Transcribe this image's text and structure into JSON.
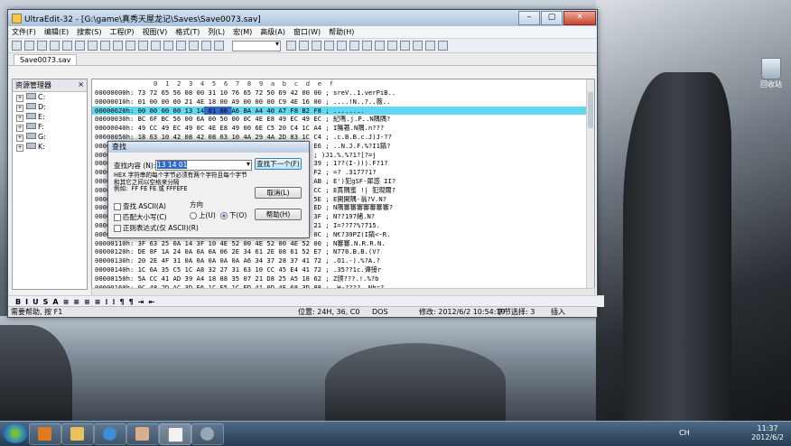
{
  "window": {
    "title": "UltraEdit-32 - [G:\\game\\真秀天屋龙记\\Saves\\Save0073.sav]",
    "buttons": {
      "minimize": "–",
      "maximize": "▢",
      "close": "✕"
    }
  },
  "menu": [
    "文件(F)",
    "编辑(E)",
    "搜索(S)",
    "工程(P)",
    "视图(V)",
    "格式(T)",
    "列(L)",
    "宏(M)",
    "高级(A)",
    "窗口(W)",
    "帮助(H)"
  ],
  "tab": {
    "label": "Save0073.sav"
  },
  "explorer": {
    "title": "资源管理器",
    "drives": [
      "C:",
      "D:",
      "E:",
      "F:",
      "G:",
      "K:"
    ]
  },
  "hex": {
    "ruler": "0  1  2  3  4  5  6  7  8  9  a  b  c  d  e  f",
    "highlight_row": 2,
    "rows": [
      {
        "addr": "00000000h:",
        "bytes": "73 72 65 56 08 00 31 10 76 65 72 50 69 42 00 00",
        "text": "; sreV..1.verPiB.."
      },
      {
        "addr": "00000010h:",
        "bytes": "01 00 00 00 21 4E 18 00 A9 00 00 00 C9 4E 16 00",
        "text": "; ....!N..?..薇.."
      },
      {
        "addr": "00000020h:",
        "bytes": "00 00 00 00 13 14 01 00 A6 BA A4 40 A7 F8 B2 F8",
        "text": "; ........"
      },
      {
        "addr": "00000030h:",
        "bytes": "BC 6F BC 56 00 6A 00 50 00 0C 4E E8 49 EC 49 EC",
        "text": "; 紀嗎.j.P..N隅隅?"
      },
      {
        "addr": "00000040h:",
        "bytes": "49 CC 49 EC 49 0C 4E E8 49 00 6E C5 20 C4 1C A4",
        "text": "; I隲著.N隅.n???"
      },
      {
        "addr": "00000050h:",
        "bytes": "18 63 10 42 08 42 08 63 10 4A 29 4A 2D 83 1C C4",
        "text": "; .c.B.B.c.J)J-??"
      },
      {
        "addr": "00000060h:",
        "bytes": "08 0B 4E 2E 4A 0E 46 07 25 A5 18 49 31 EF 55 E6",
        "text": "; ..N.J.F.%?I1錆?"
      },
      {
        "addr": "00000070h:",
        "bytes": "29 4A 31 0F 25 07 25 8C 31 0D 5B 81 CD 3D 6A",
        "text": "; )J1.%.%?1?[?=j"
      },
      {
        "addr": "00000080h:",
        "bytes": "31 0F 28 29 4A 31 0F 29 4A 31 0F 3F 6A 31 8E 39",
        "text": "; 1??(I-))).F?1?"
      },
      {
        "addr": "00000090h:",
        "bytes": "D4 9E 3F 1F 3D DF 7B 3D 0F 3F 21 43 3F 15 C9 F2",
        "text": "; =? .3177?1?"
      },
      {
        "addr": "000000a0h:",
        "bytes": "28 1B 29 8A 31 8F 59 07 C9 40 BD 38 AA 3E B2 AB",
        "text": "; E')犯gSF-犀惑 II?"
      },
      {
        "addr": "000000b0h:",
        "bytes": "8E C9 19 15 45 00 00 00 00 00 00 00 16 4E 7A CC",
        "text": "; E貫隅蜜 !| 犯現爾?"
      },
      {
        "addr": "000000c0h:",
        "bytes": "18 00 0C 4E 94 56 54 EC 4E F6 AD 15 EF 5B 3F 5E",
        "text": "; E開開隅·翁?V.N?"
      },
      {
        "addr": "000000d0h:",
        "bytes": "49 6E EC 6E 49 EC C4 49 EC 49 C4 49 EC 49 C4 ED",
        "text": "; N隅審審審審審審審?"
      },
      {
        "addr": "000000e0h:",
        "bytes": "49 0C 4E 0F 31 00 E7 31 24 0C E8 18 0C 4E 4E 3F",
        "text": "; N??197緒.N?"
      },
      {
        "addr": "000000f0h:",
        "bytes": "40 68 49 49 49 0C 37 70 37 37 06 04 37 06 39 21",
        "text": "; I=??7?%?715."
      },
      {
        "addr": "00000100h:",
        "bytes": "0C 4E F7 38 35 1C 50 50 32 2E 28 0D 00 00 00 0C",
        "text": "; N€?39PZ(I錆<-R."
      },
      {
        "addr": "00000110h:",
        "bytes": "3F 63 25 0A 14 3F 10 4E 52 00 4E 52 00 4E 52 00",
        "text": "; N審審.N.R.R.N."
      },
      {
        "addr": "00000120h:",
        "bytes": "DE 8F 1A 24 0A 0A 0A 06 2E 34 61 2E 08 61 52 E7",
        "text": "; N778.B.B.(V?"
      },
      {
        "addr": "00000130h:",
        "bytes": "20 2E 4F 31 0A 0A 0A 0A 0A A6 34 37 28 37 41 72",
        "text": "; .O1.-).%?A.?"
      },
      {
        "addr": "00000140h:",
        "bytes": "1C 6A 35 C5 1C A8 32 27 31 63 10 CC 45 E4 41 72",
        "text": "; .35??1c.谭接r"
      },
      {
        "addr": "00000150h:",
        "bytes": "5A CC 41 AD 39 A4 18 88 35 07 21 D8 25 A5 18 62",
        "text": "; Z颁???.!.%?b"
      },
      {
        "addr": "00000160h:",
        "bytes": "0C 48 2D AC 3D E6 1C E5 1C ED 41 0D 4E 68 3D 88",
        "text": "; .H-???? .Nh=?"
      },
      {
        "addr": "00000170h:",
        "bytes": "41 27 3D 89 41 88 41 25 2D A8 45 48 35 67 31 A9",
        "text": "; A'=瓢隅…隅KSg1?"
      },
      {
        "addr": "00000180h:",
        "bytes": "45 AB 45 AA 45 0C 4E A6 49 EB 45 CA 49 CA 49 AA",
        "text": "; E隅貌.N隅隅隅隅?"
      }
    ]
  },
  "format_bar": [
    "B",
    "I",
    "U",
    "S",
    "A",
    "≡",
    "≡",
    "≡",
    "≡",
    "⁝",
    "⁝",
    "¶",
    "¶",
    "⇥",
    "⇤"
  ],
  "status": {
    "help": "需要帮助, 按 F1",
    "position": "位置: 24H, 36, C0",
    "mode": "DOS",
    "modified": "修改: 2012/6/2 10:54:19",
    "selection": "字节选择: 3",
    "insert": "插入"
  },
  "dialog": {
    "title": "查找",
    "find_label": "查找内容 (N):",
    "find_value": "13 14 01",
    "hint": "HEX 字符串的每个字节必须有两个字符且每个字节和其它之间以空格来分隔\n例如:  FF FE FE 或 FFFEFE",
    "find_next": "查找下一个(F)",
    "cancel": "取消(L)",
    "help": "帮助(H)",
    "find_ascii": "查找 ASCII(A)",
    "match_case": "匹配大小写(C)",
    "regex": "正则表达式(仅 ASCII)(R)",
    "direction_label": "方向",
    "dir_up": "上(U)",
    "dir_down": "下(O)"
  },
  "desktop": {
    "recycle_bin": "回收站"
  },
  "taskbar": {
    "tray_lang": "CH",
    "time": "11:37",
    "date": "2012/6/2"
  }
}
